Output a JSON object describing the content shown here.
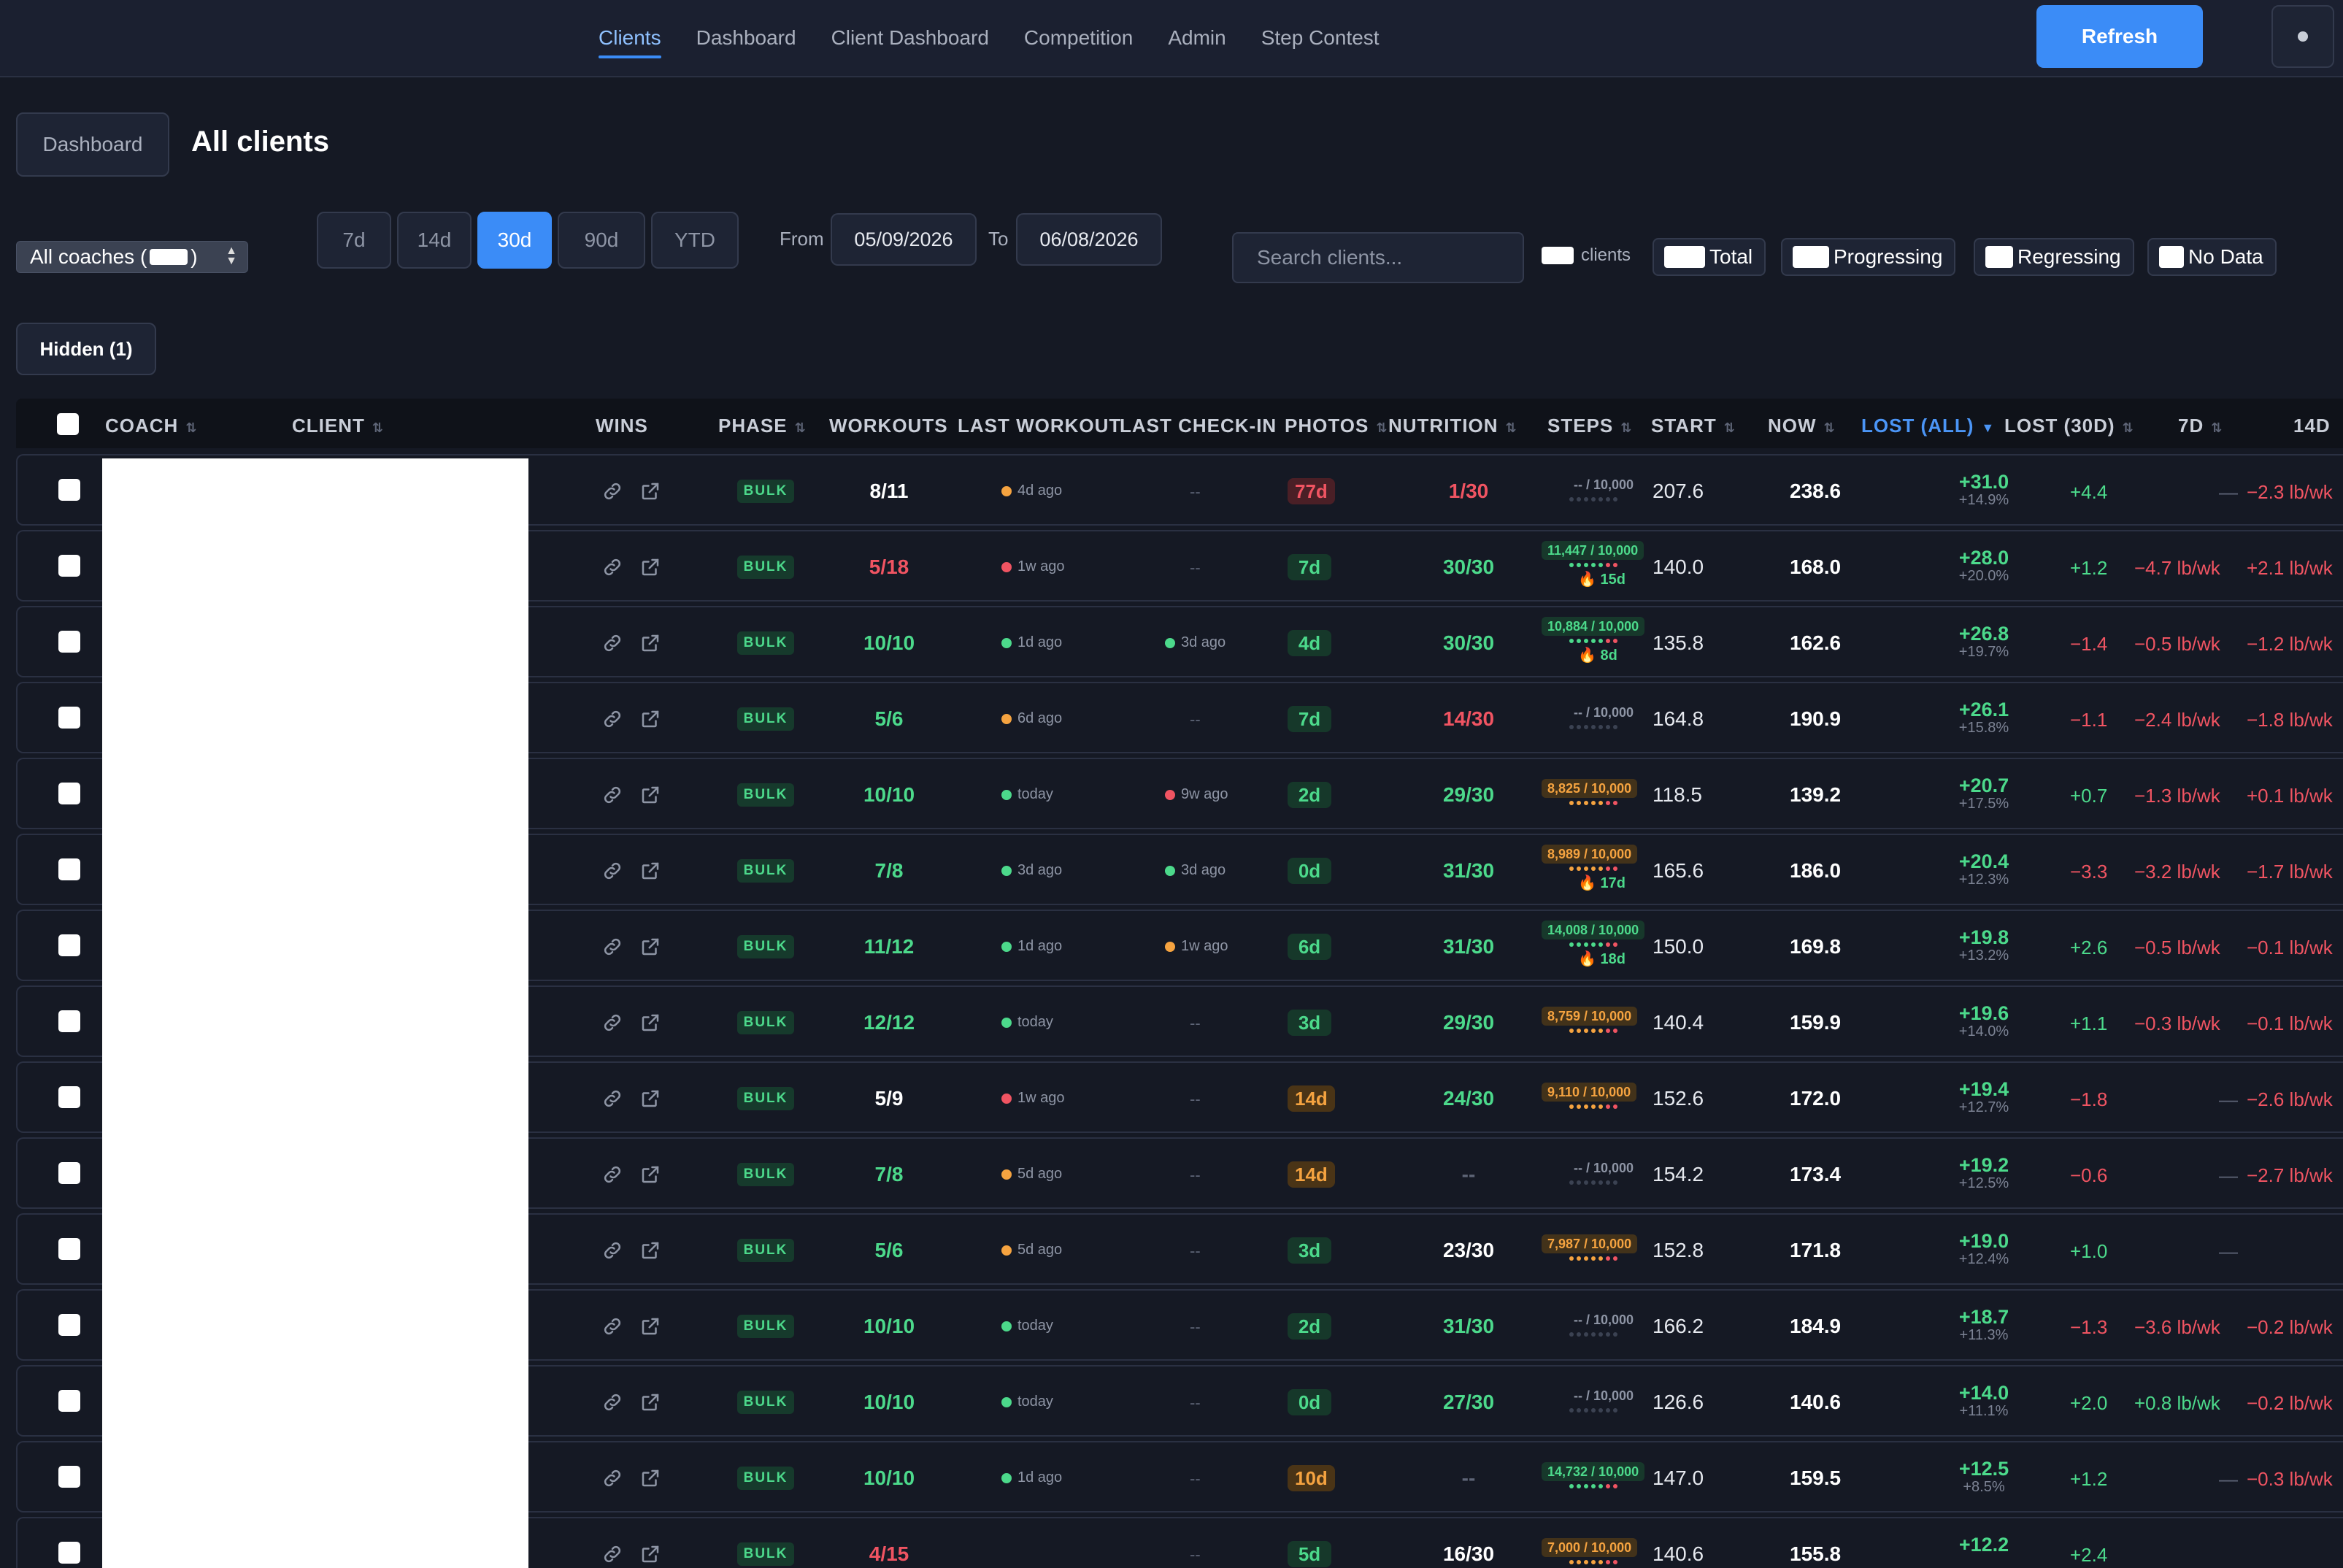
{
  "nav": {
    "items": [
      "Clients",
      "Dashboard",
      "Client Dashboard",
      "Competition",
      "Admin",
      "Step Contest"
    ],
    "active": "Clients",
    "refresh_label": "Refresh"
  },
  "header": {
    "dashboard_label": "Dashboard",
    "title": "All clients"
  },
  "filters": {
    "coach_select": {
      "label_prefix": "All coaches (",
      "label_suffix": ")"
    },
    "ranges": [
      "7d",
      "14d",
      "30d",
      "90d",
      "YTD"
    ],
    "active_range": "30d",
    "from_label": "From",
    "from_value": "05/09/2026",
    "to_label": "To",
    "to_value": "06/08/2026",
    "search_placeholder": "Search clients...",
    "count_suffix": "clients",
    "chips": [
      "Total",
      "Progressing",
      "Regressing",
      "No Data"
    ],
    "hidden_label": "Hidden (1)"
  },
  "table": {
    "columns": {
      "coach": "COACH",
      "client": "CLIENT",
      "wins": "WINS",
      "phase": "PHASE",
      "workouts": "WORKOUTS",
      "last_workout": "LAST WORKOUT",
      "last_checkin": "LAST CHECK-IN",
      "photos": "PHOTOS",
      "nutrition": "NUTRITION",
      "steps": "STEPS",
      "start": "START",
      "now": "NOW",
      "lost_all": "LOST (ALL)",
      "lost_30d": "LOST (30D)",
      "d7": "7D",
      "d14": "14D"
    },
    "sort_icon": "⇅",
    "sorted_icon": "▼",
    "rows": [
      {
        "phase": "BULK",
        "workouts": "8/11",
        "wk_color": "default",
        "last_workout": "4d ago",
        "lw_dot": "o",
        "last_checkin": "--",
        "ci_dot": "",
        "photos": "77d",
        "ph_color": "r",
        "nutrition": "1/30",
        "nu_color": "r",
        "steps": "-- / 10,000",
        "st_color": "none",
        "streak": "",
        "start": "207.6",
        "now": "238.6",
        "lost_all": "+31.0",
        "lost_pct": "+14.9%",
        "lost_30d": "+4.4",
        "l30_color": "g",
        "d7": "—",
        "d7_color": "muted",
        "d14": "−2.3 lb/wk",
        "d14_color": "r"
      },
      {
        "phase": "BULK",
        "workouts": "5/18",
        "wk_color": "r",
        "last_workout": "1w ago",
        "lw_dot": "r",
        "last_checkin": "--",
        "ci_dot": "",
        "photos": "7d",
        "ph_color": "g",
        "nutrition": "30/30",
        "nu_color": "g",
        "steps": "11,447 / 10,000",
        "st_color": "g",
        "streak": "🔥 15d",
        "start": "140.0",
        "now": "168.0",
        "lost_all": "+28.0",
        "lost_pct": "+20.0%",
        "lost_30d": "+1.2",
        "l30_color": "g",
        "d7": "−4.7 lb/wk",
        "d7_color": "r",
        "d14": "+2.1 lb/wk",
        "d14_color": "r"
      },
      {
        "phase": "BULK",
        "workouts": "10/10",
        "wk_color": "g",
        "last_workout": "1d ago",
        "lw_dot": "g",
        "last_checkin": "3d ago",
        "ci_dot": "g",
        "photos": "4d",
        "ph_color": "g",
        "nutrition": "30/30",
        "nu_color": "g",
        "steps": "10,884 / 10,000",
        "st_color": "g",
        "streak": "🔥 8d",
        "start": "135.8",
        "now": "162.6",
        "lost_all": "+26.8",
        "lost_pct": "+19.7%",
        "lost_30d": "−1.4",
        "l30_color": "r",
        "d7": "−0.5 lb/wk",
        "d7_color": "r",
        "d14": "−1.2 lb/wk",
        "d14_color": "r"
      },
      {
        "phase": "BULK",
        "workouts": "5/6",
        "wk_color": "g",
        "last_workout": "6d ago",
        "lw_dot": "o",
        "last_checkin": "--",
        "ci_dot": "",
        "photos": "7d",
        "ph_color": "g",
        "nutrition": "14/30",
        "nu_color": "r",
        "steps": "-- / 10,000",
        "st_color": "none",
        "streak": "",
        "start": "164.8",
        "now": "190.9",
        "lost_all": "+26.1",
        "lost_pct": "+15.8%",
        "lost_30d": "−1.1",
        "l30_color": "r",
        "d7": "−2.4 lb/wk",
        "d7_color": "r",
        "d14": "−1.8 lb/wk",
        "d14_color": "r"
      },
      {
        "phase": "BULK",
        "workouts": "10/10",
        "wk_color": "g",
        "last_workout": "today",
        "lw_dot": "g",
        "last_checkin": "9w ago",
        "ci_dot": "r",
        "photos": "2d",
        "ph_color": "g",
        "nutrition": "29/30",
        "nu_color": "g",
        "steps": "8,825 / 10,000",
        "st_color": "o",
        "streak": "",
        "start": "118.5",
        "now": "139.2",
        "lost_all": "+20.7",
        "lost_pct": "+17.5%",
        "lost_30d": "+0.7",
        "l30_color": "g",
        "d7": "−1.3 lb/wk",
        "d7_color": "r",
        "d14": "+0.1 lb/wk",
        "d14_color": "r"
      },
      {
        "phase": "BULK",
        "workouts": "7/8",
        "wk_color": "g",
        "last_workout": "3d ago",
        "lw_dot": "g",
        "last_checkin": "3d ago",
        "ci_dot": "g",
        "photos": "0d",
        "ph_color": "g",
        "nutrition": "31/30",
        "nu_color": "g",
        "steps": "8,989 / 10,000",
        "st_color": "o",
        "streak": "🔥 17d",
        "start": "165.6",
        "now": "186.0",
        "lost_all": "+20.4",
        "lost_pct": "+12.3%",
        "lost_30d": "−3.3",
        "l30_color": "r",
        "d7": "−3.2 lb/wk",
        "d7_color": "r",
        "d14": "−1.7 lb/wk",
        "d14_color": "r"
      },
      {
        "phase": "BULK",
        "workouts": "11/12",
        "wk_color": "g",
        "last_workout": "1d ago",
        "lw_dot": "g",
        "last_checkin": "1w ago",
        "ci_dot": "o",
        "photos": "6d",
        "ph_color": "g",
        "nutrition": "31/30",
        "nu_color": "g",
        "steps": "14,008 / 10,000",
        "st_color": "g",
        "streak": "🔥 18d",
        "start": "150.0",
        "now": "169.8",
        "lost_all": "+19.8",
        "lost_pct": "+13.2%",
        "lost_30d": "+2.6",
        "l30_color": "g",
        "d7": "−0.5 lb/wk",
        "d7_color": "r",
        "d14": "−0.1 lb/wk",
        "d14_color": "r"
      },
      {
        "phase": "BULK",
        "workouts": "12/12",
        "wk_color": "g",
        "last_workout": "today",
        "lw_dot": "g",
        "last_checkin": "--",
        "ci_dot": "",
        "photos": "3d",
        "ph_color": "g",
        "nutrition": "29/30",
        "nu_color": "g",
        "steps": "8,759 / 10,000",
        "st_color": "o",
        "streak": "",
        "start": "140.4",
        "now": "159.9",
        "lost_all": "+19.6",
        "lost_pct": "+14.0%",
        "lost_30d": "+1.1",
        "l30_color": "g",
        "d7": "−0.3 lb/wk",
        "d7_color": "r",
        "d14": "−0.1 lb/wk",
        "d14_color": "r"
      },
      {
        "phase": "BULK",
        "workouts": "5/9",
        "wk_color": "default",
        "last_workout": "1w ago",
        "lw_dot": "r",
        "last_checkin": "--",
        "ci_dot": "",
        "photos": "14d",
        "ph_color": "o",
        "nutrition": "24/30",
        "nu_color": "g",
        "steps": "9,110 / 10,000",
        "st_color": "o",
        "streak": "",
        "start": "152.6",
        "now": "172.0",
        "lost_all": "+19.4",
        "lost_pct": "+12.7%",
        "lost_30d": "−1.8",
        "l30_color": "r",
        "d7": "—",
        "d7_color": "muted",
        "d14": "−2.6 lb/wk",
        "d14_color": "r"
      },
      {
        "phase": "BULK",
        "workouts": "7/8",
        "wk_color": "g",
        "last_workout": "5d ago",
        "lw_dot": "o",
        "last_checkin": "--",
        "ci_dot": "",
        "photos": "14d",
        "ph_color": "o",
        "nutrition": "--",
        "nu_color": "muted",
        "steps": "-- / 10,000",
        "st_color": "none",
        "streak": "",
        "start": "154.2",
        "now": "173.4",
        "lost_all": "+19.2",
        "lost_pct": "+12.5%",
        "lost_30d": "−0.6",
        "l30_color": "r",
        "d7": "—",
        "d7_color": "muted",
        "d14": "−2.7 lb/wk",
        "d14_color": "r"
      },
      {
        "phase": "BULK",
        "workouts": "5/6",
        "wk_color": "g",
        "last_workout": "5d ago",
        "lw_dot": "o",
        "last_checkin": "--",
        "ci_dot": "",
        "photos": "3d",
        "ph_color": "g",
        "nutrition": "23/30",
        "nu_color": "default",
        "steps": "7,987 / 10,000",
        "st_color": "o",
        "streak": "",
        "start": "152.8",
        "now": "171.8",
        "lost_all": "+19.0",
        "lost_pct": "+12.4%",
        "lost_30d": "+1.0",
        "l30_color": "g",
        "d7": "—",
        "d7_color": "muted",
        "d14": "",
        "d14_color": "r"
      },
      {
        "phase": "BULK",
        "workouts": "10/10",
        "wk_color": "g",
        "last_workout": "today",
        "lw_dot": "g",
        "last_checkin": "--",
        "ci_dot": "",
        "photos": "2d",
        "ph_color": "g",
        "nutrition": "31/30",
        "nu_color": "g",
        "steps": "-- / 10,000",
        "st_color": "none",
        "streak": "",
        "start": "166.2",
        "now": "184.9",
        "lost_all": "+18.7",
        "lost_pct": "+11.3%",
        "lost_30d": "−1.3",
        "l30_color": "r",
        "d7": "−3.6 lb/wk",
        "d7_color": "r",
        "d14": "−0.2 lb/wk",
        "d14_color": "r"
      },
      {
        "phase": "BULK",
        "workouts": "10/10",
        "wk_color": "g",
        "last_workout": "today",
        "lw_dot": "g",
        "last_checkin": "--",
        "ci_dot": "",
        "photos": "0d",
        "ph_color": "g",
        "nutrition": "27/30",
        "nu_color": "g",
        "steps": "-- / 10,000",
        "st_color": "none",
        "streak": "",
        "start": "126.6",
        "now": "140.6",
        "lost_all": "+14.0",
        "lost_pct": "+11.1%",
        "lost_30d": "+2.0",
        "l30_color": "g",
        "d7": "+0.8 lb/wk",
        "d7_color": "g",
        "d14": "−0.2 lb/wk",
        "d14_color": "r"
      },
      {
        "phase": "BULK",
        "workouts": "10/10",
        "wk_color": "g",
        "last_workout": "1d ago",
        "lw_dot": "g",
        "last_checkin": "--",
        "ci_dot": "",
        "photos": "10d",
        "ph_color": "o",
        "nutrition": "--",
        "nu_color": "muted",
        "steps": "14,732 / 10,000",
        "st_color": "g",
        "streak": "",
        "start": "147.0",
        "now": "159.5",
        "lost_all": "+12.5",
        "lost_pct": "+8.5%",
        "lost_30d": "+1.2",
        "l30_color": "g",
        "d7": "—",
        "d7_color": "muted",
        "d14": "−0.3 lb/wk",
        "d14_color": "r"
      },
      {
        "phase": "BULK",
        "workouts": "4/15",
        "wk_color": "r",
        "last_workout": "",
        "lw_dot": "g",
        "last_checkin": "--",
        "ci_dot": "",
        "photos": "5d",
        "ph_color": "g",
        "nutrition": "16/30",
        "nu_color": "default",
        "steps": "7,000 / 10,000",
        "st_color": "o",
        "streak": "",
        "start": "140.6",
        "now": "155.8",
        "lost_all": "+12.2",
        "lost_pct": "",
        "lost_30d": "+2.4",
        "l30_color": "g",
        "d7": "",
        "d7_color": "muted",
        "d14": "",
        "d14_color": "r"
      }
    ]
  },
  "colors": {
    "accent": "#3b8cf7",
    "green": "#4cd98b",
    "red": "#f05462",
    "orange": "#f5a340",
    "bg": "#151924"
  },
  "icons": [
    "link-icon",
    "external-link-icon",
    "sort-icon",
    "flame-icon",
    "menu-dot-icon"
  ]
}
